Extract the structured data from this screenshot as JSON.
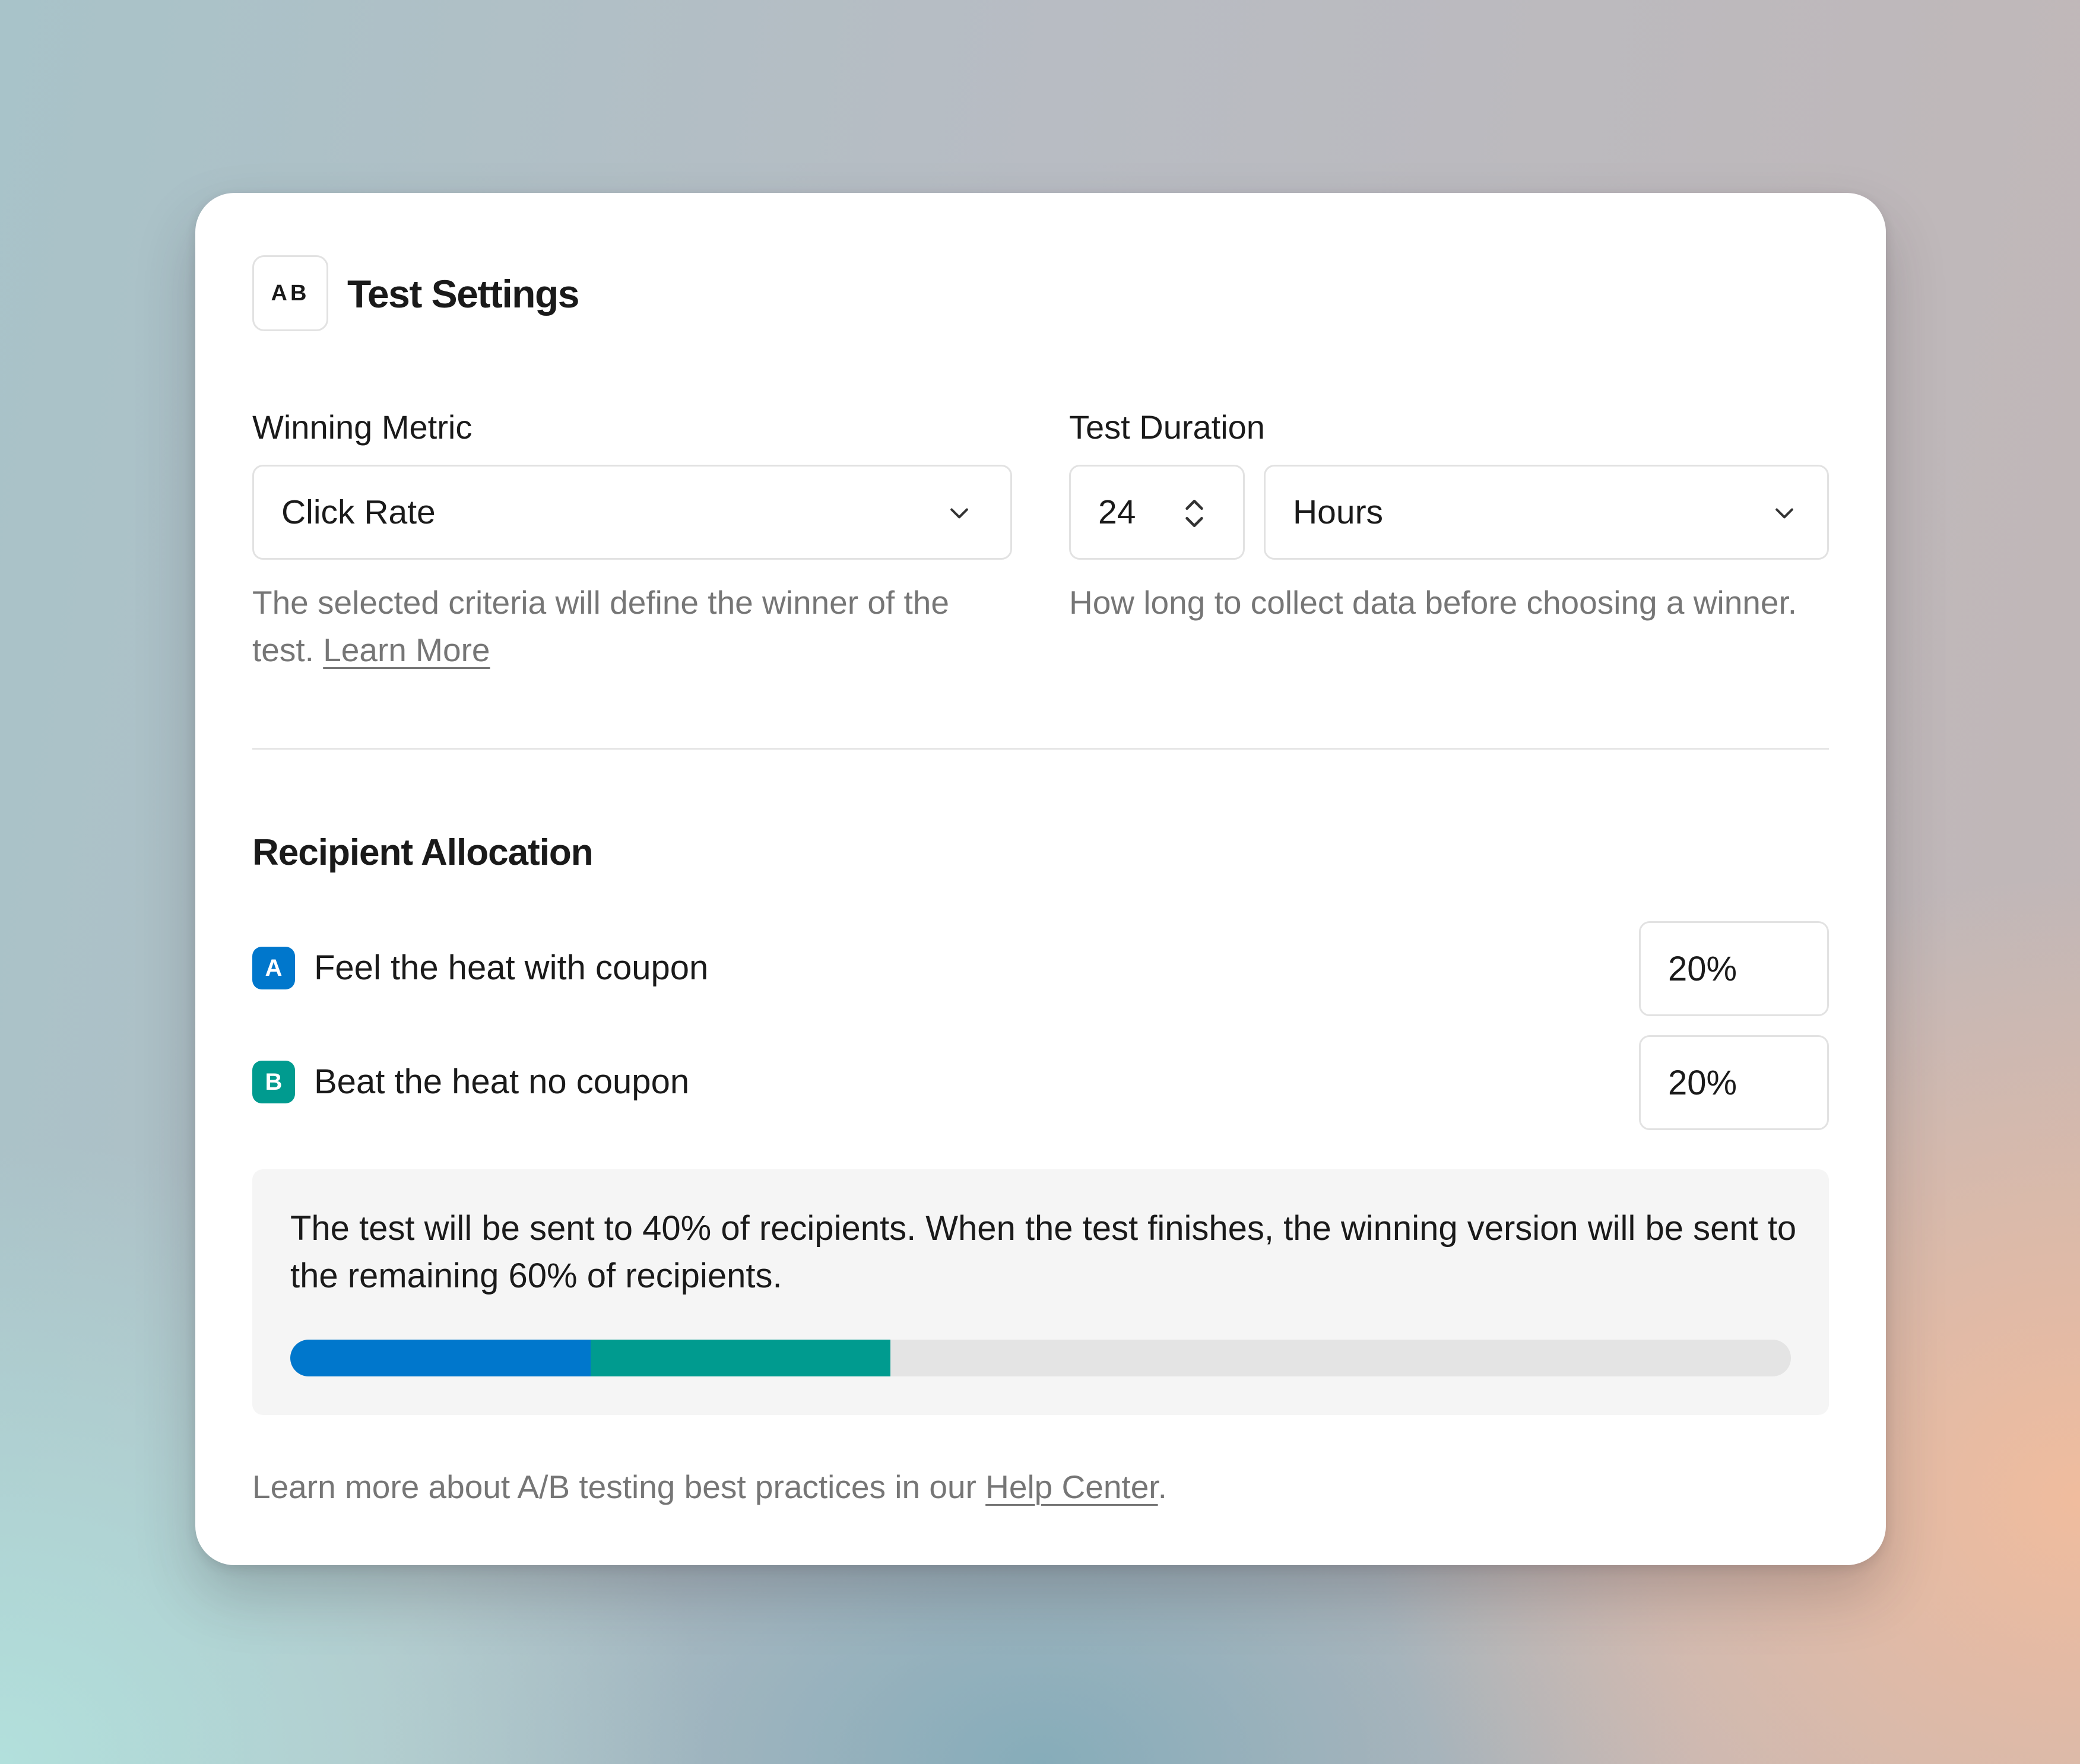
{
  "header": {
    "icon_text": "AB",
    "title": "Test Settings"
  },
  "winning_metric": {
    "label": "Winning Metric",
    "selected": "Click Rate",
    "helper": "The selected criteria will define the winner of the test.",
    "helper_link": "Learn More"
  },
  "test_duration": {
    "label": "Test Duration",
    "amount": "24",
    "unit": "Hours",
    "helper": "How long to collect data before choosing a winner."
  },
  "allocation": {
    "title": "Recipient Allocation",
    "variants": [
      {
        "badge": "A",
        "name": "Feel the heat with coupon",
        "percent": "20%",
        "share": 0.2,
        "color": "#0077cc"
      },
      {
        "badge": "B",
        "name": "Beat the heat no coupon",
        "percent": "20%",
        "share": 0.2,
        "color": "#009b8f"
      }
    ],
    "summary": "The test will be sent to 40% of recipients. When the test finishes, the winning version will be sent to the remaining 60% of recipients."
  },
  "footer": {
    "text": "Learn more about A/B testing best practices in our",
    "link": "Help Center",
    "suffix": "."
  }
}
